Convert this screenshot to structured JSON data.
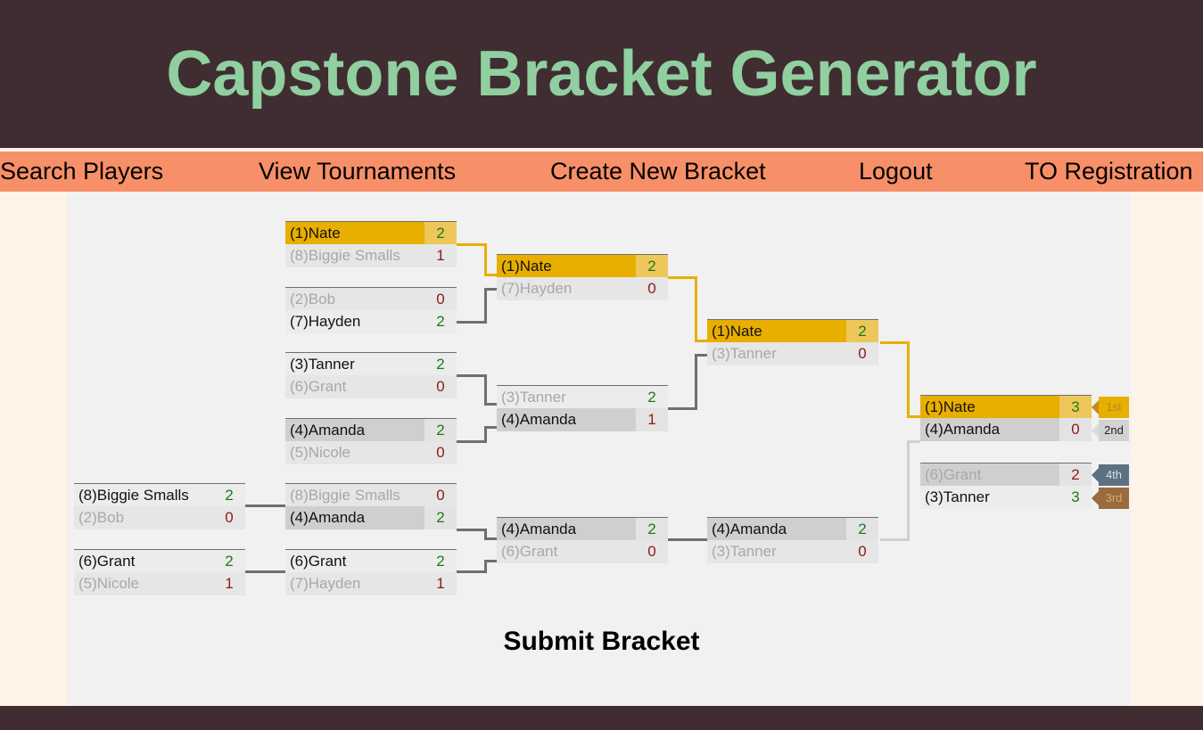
{
  "header": {
    "title": "Capstone Bracket Generator",
    "title_color": "#90cfa0",
    "bg_color": "#402d31"
  },
  "nav": {
    "bg_color": "#f78f68",
    "items": [
      {
        "label": "Search Players"
      },
      {
        "label": "View Tournaments"
      },
      {
        "label": "Create New Bracket"
      },
      {
        "label": "Logout"
      },
      {
        "label": "TO Registration"
      }
    ]
  },
  "actions": {
    "submit_label": "Submit Bracket"
  },
  "colors": {
    "winner_gold": "#e8ae00",
    "winner_gold_score": "#eec75a",
    "slot_dark": "#cfcfcf",
    "slot_light": "#e6e6e6",
    "score_win": "#1a7a1a",
    "score_lose": "#8b1a1a",
    "panel": "#f1f1f1",
    "page": "#fdf3e7"
  },
  "bracket": {
    "winners_round1": [
      {
        "top": {
          "name": "(1)Nate",
          "score": "2"
        },
        "bottom": {
          "name": "(8)Biggie Smalls",
          "score": "1"
        }
      },
      {
        "top": {
          "name": "(2)Bob",
          "score": "0"
        },
        "bottom": {
          "name": "(7)Hayden",
          "score": "2"
        }
      },
      {
        "top": {
          "name": "(3)Tanner",
          "score": "2"
        },
        "bottom": {
          "name": "(6)Grant",
          "score": "0"
        }
      },
      {
        "top": {
          "name": "(4)Amanda",
          "score": "2"
        },
        "bottom": {
          "name": "(5)Nicole",
          "score": "0"
        }
      }
    ],
    "winners_round2": [
      {
        "top": {
          "name": "(1)Nate",
          "score": "2"
        },
        "bottom": {
          "name": "(7)Hayden",
          "score": "0"
        }
      },
      {
        "top": {
          "name": "(3)Tanner",
          "score": "2"
        },
        "bottom": {
          "name": "(4)Amanda",
          "score": "1"
        }
      }
    ],
    "winners_semifinal": [
      {
        "top": {
          "name": "(1)Nate",
          "score": "2"
        },
        "bottom": {
          "name": "(3)Tanner",
          "score": "0"
        }
      }
    ],
    "losers_round1": [
      {
        "top": {
          "name": "(8)Biggie Smalls",
          "score": "2"
        },
        "bottom": {
          "name": "(2)Bob",
          "score": "0"
        }
      },
      {
        "top": {
          "name": "(6)Grant",
          "score": "2"
        },
        "bottom": {
          "name": "(5)Nicole",
          "score": "1"
        }
      }
    ],
    "losers_round2": [
      {
        "top": {
          "name": "(8)Biggie Smalls",
          "score": "0"
        },
        "bottom": {
          "name": "(4)Amanda",
          "score": "2"
        }
      },
      {
        "top": {
          "name": "(6)Grant",
          "score": "2"
        },
        "bottom": {
          "name": "(7)Hayden",
          "score": "1"
        }
      }
    ],
    "losers_round3": [
      {
        "top": {
          "name": "(4)Amanda",
          "score": "2"
        },
        "bottom": {
          "name": "(6)Grant",
          "score": "0"
        }
      }
    ],
    "losers_final": [
      {
        "top": {
          "name": "(4)Amanda",
          "score": "2"
        },
        "bottom": {
          "name": "(3)Tanner",
          "score": "0"
        }
      }
    ],
    "grand_final": [
      {
        "top": {
          "name": "(1)Nate",
          "score": "3",
          "place": "1st"
        },
        "bottom": {
          "name": "(4)Amanda",
          "score": "0",
          "place": "2nd"
        }
      }
    ],
    "third_place": [
      {
        "top": {
          "name": "(6)Grant",
          "score": "2",
          "place": "4th"
        },
        "bottom": {
          "name": "(3)Tanner",
          "score": "3",
          "place": "3rd"
        }
      }
    ]
  }
}
